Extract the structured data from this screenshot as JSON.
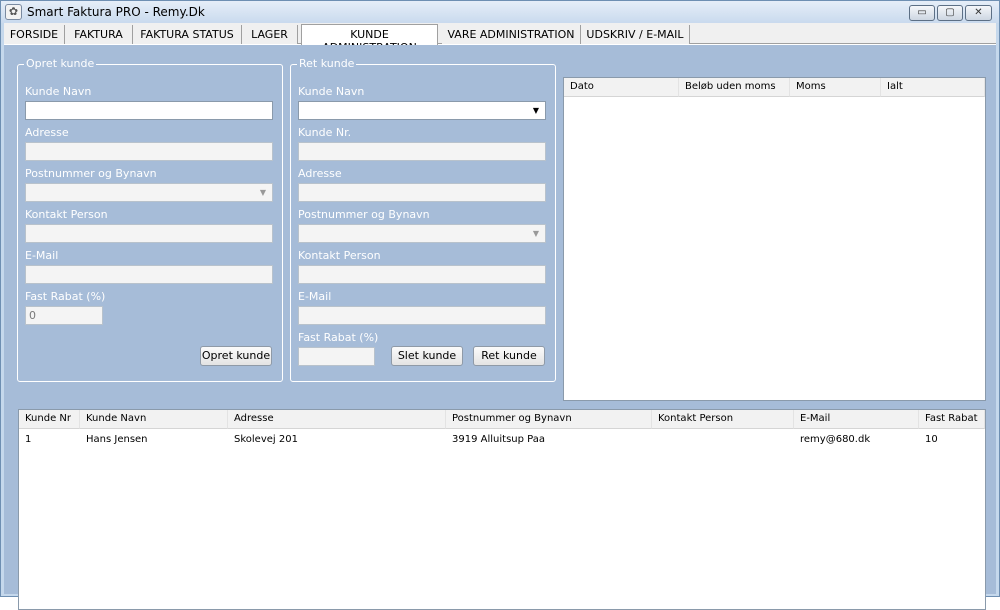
{
  "window": {
    "title": "Smart Faktura PRO  -  Remy.Dk",
    "icon": "app-icon",
    "controls": {
      "minimize": "▭",
      "maximize": "▢",
      "close": "✕"
    }
  },
  "tabs": [
    {
      "label": "FORSIDE"
    },
    {
      "label": "FAKTURA"
    },
    {
      "label": "FAKTURA STATUS"
    },
    {
      "label": "LAGER"
    },
    {
      "label": "KUNDE ADMINISTRATION",
      "active": true
    },
    {
      "label": "VARE ADMINISTRATION"
    },
    {
      "label": "UDSKRIV / E-MAIL"
    }
  ],
  "opret": {
    "legend": "Opret kunde",
    "name_label": "Kunde Navn",
    "name_value": "",
    "address_label": "Adresse",
    "address_value": "",
    "postal_label": "Postnummer og Bynavn",
    "postal_value": "",
    "contact_label": "Kontakt Person",
    "contact_value": "",
    "email_label": "E-Mail",
    "email_value": "",
    "rabat_label": "Fast Rabat (%)",
    "rabat_value": "0",
    "button": "Opret kunde"
  },
  "ret": {
    "legend": "Ret kunde",
    "name_label": "Kunde Navn",
    "name_value": "",
    "nr_label": "Kunde Nr.",
    "nr_value": "",
    "address_label": "Adresse",
    "address_value": "",
    "postal_label": "Postnummer og Bynavn",
    "postal_value": "",
    "contact_label": "Kontakt Person",
    "contact_value": "",
    "email_label": "E-Mail",
    "email_value": "",
    "rabat_label": "Fast Rabat (%)",
    "rabat_value": "",
    "delete_button": "Slet kunde",
    "edit_button": "Ret kunde"
  },
  "invoice_grid": {
    "headers": [
      "Dato",
      "Beløb uden moms",
      "Moms",
      "Ialt"
    ]
  },
  "customer_grid": {
    "headers": [
      "Kunde Nr",
      "Kunde Navn",
      "Adresse",
      "Postnummer og Bynavn",
      "Kontakt Person",
      "E-Mail",
      "Fast Rabat"
    ],
    "rows": [
      [
        "1",
        "Hans Jensen",
        "Skolevej 201",
        "3919 Alluitsup Paa",
        "",
        "remy@680.dk",
        "10"
      ]
    ]
  }
}
